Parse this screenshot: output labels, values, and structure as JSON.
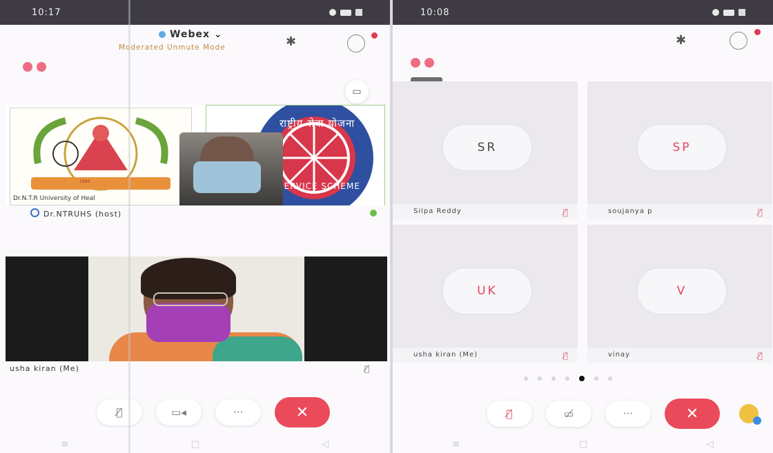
{
  "left_phone": {
    "status_time": "10:17",
    "app_title": "Webex",
    "mode_text": "Moderated Unmute Mode",
    "host_label": "Dr.NTRUHS (host)",
    "crest_caption": "Dr.N.T.R University of Heal",
    "nss_text": "SERVICE SCHEME",
    "nss_hindi": "राष्ट्रीय सेवा योजना",
    "self_label": "usha kiran (Me)",
    "controls": {
      "mute": "mic-off-icon",
      "video": "camera-icon",
      "more": "···",
      "end": "✕"
    }
  },
  "right_phone": {
    "status_time": "10:08",
    "participants": [
      {
        "initials": "SR",
        "name": "Silpa Reddy",
        "color": "#444"
      },
      {
        "initials": "SP",
        "name": "soujanya p",
        "color": "#e2475e"
      },
      {
        "initials": "UK",
        "name": "usha kiran (Me)",
        "color": "#e2475e"
      },
      {
        "initials": "V",
        "name": "vinay",
        "color": "#e2475e"
      }
    ],
    "controls": {
      "mute": "mic-off-icon",
      "video": "camera-off-icon",
      "more": "···",
      "end": "✕"
    }
  }
}
